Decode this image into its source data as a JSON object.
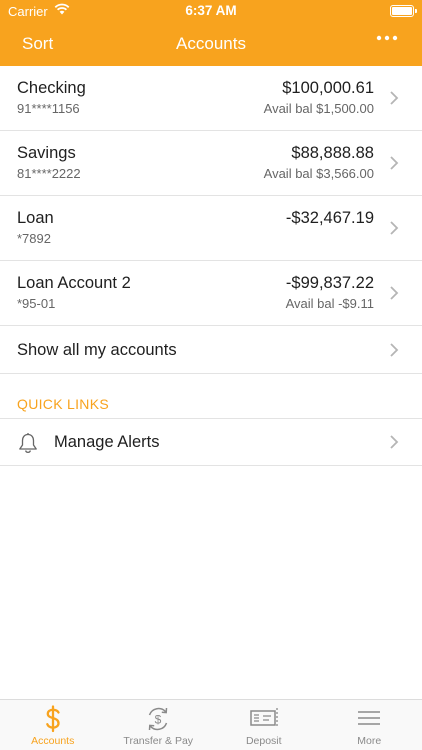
{
  "status": {
    "carrier": "Carrier",
    "time": "6:37 AM"
  },
  "nav": {
    "left": "Sort",
    "title": "Accounts",
    "more": "•••"
  },
  "accounts": [
    {
      "name": "Checking",
      "number": "91****1156",
      "balance": "$100,000.61",
      "avail": "Avail bal $1,500.00"
    },
    {
      "name": "Savings",
      "number": "81****2222",
      "balance": "$88,888.88",
      "avail": "Avail bal $3,566.00"
    },
    {
      "name": "Loan",
      "number": "*7892",
      "balance": "-$32,467.19",
      "avail": ""
    },
    {
      "name": "Loan Account 2",
      "number": "*95-01",
      "balance": "-$99,837.22",
      "avail": "Avail bal -$9.11"
    }
  ],
  "show_all": "Show all my accounts",
  "quick_links": {
    "header": "QUICK LINKS",
    "items": [
      {
        "label": "Manage Alerts",
        "icon": "bell-icon"
      }
    ]
  },
  "tabs": [
    {
      "label": "Accounts",
      "icon": "dollar-icon",
      "active": true
    },
    {
      "label": "Transfer & Pay",
      "icon": "transfer-icon",
      "active": false
    },
    {
      "label": "Deposit",
      "icon": "check-deposit-icon",
      "active": false
    },
    {
      "label": "More",
      "icon": "menu-icon",
      "active": false
    }
  ],
  "colors": {
    "accent": "#f8a31e",
    "tab_inactive": "#8a8a8a"
  }
}
